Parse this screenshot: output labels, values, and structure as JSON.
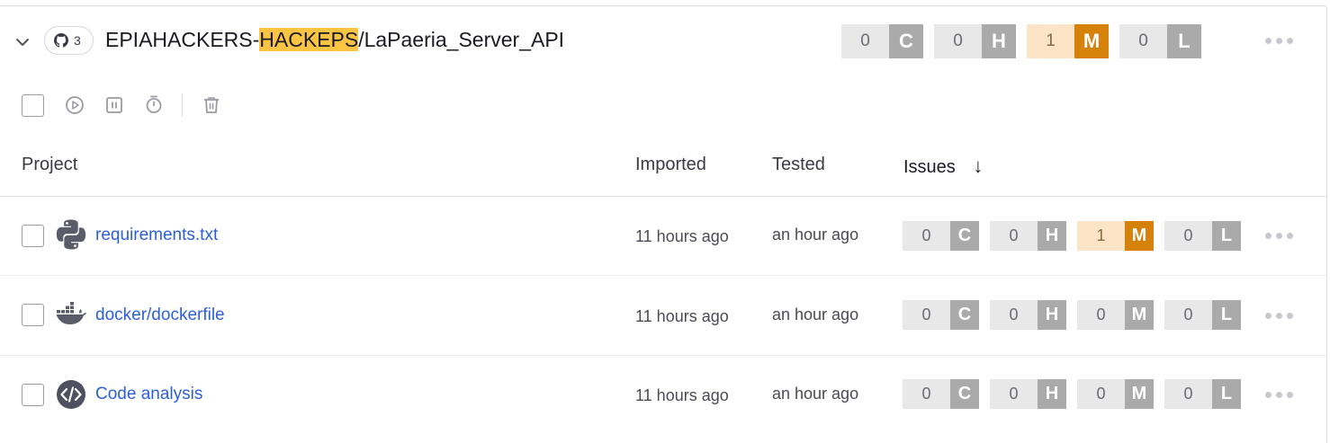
{
  "repo": {
    "source_count": "3",
    "title_prefix": "EPIAHACKERS-",
    "title_highlight": "HACKEPS",
    "title_suffix": "/LaPaeria_Server_API",
    "highlight_color": "#fbc543",
    "summary": {
      "critical": {
        "count": "0",
        "letter": "C"
      },
      "high": {
        "count": "0",
        "letter": "H"
      },
      "medium": {
        "count": "1",
        "letter": "M"
      },
      "low": {
        "count": "0",
        "letter": "L"
      }
    }
  },
  "toolbar": {
    "icons": [
      "select-all-checkbox",
      "play-circle-icon",
      "pause-icon",
      "timer-icon",
      "trash-icon"
    ]
  },
  "columns": {
    "project": "Project",
    "imported": "Imported",
    "tested": "Tested",
    "issues": "Issues",
    "issues_sort": "↓"
  },
  "rows": [
    {
      "icon": "python-icon",
      "name": "requirements.txt",
      "imported": "11 hours ago",
      "tested": "an hour ago",
      "issues": {
        "c": "0",
        "h": "0",
        "m": "1",
        "l": "0",
        "cl": "C",
        "hl": "H",
        "ml": "M",
        "ll": "L"
      }
    },
    {
      "icon": "docker-icon",
      "name": "docker/dockerfile",
      "imported": "11 hours ago",
      "tested": "an hour ago",
      "issues": {
        "c": "0",
        "h": "0",
        "m": "0",
        "l": "0",
        "cl": "C",
        "hl": "H",
        "ml": "M",
        "ll": "L"
      }
    },
    {
      "icon": "code-analysis-icon",
      "name": "Code analysis",
      "imported": "11 hours ago",
      "tested": "an hour ago",
      "issues": {
        "c": "0",
        "h": "0",
        "m": "0",
        "l": "0",
        "cl": "C",
        "hl": "H",
        "ml": "M",
        "ll": "L"
      }
    }
  ],
  "colors": {
    "link": "#2b5fd9",
    "medium": "#d6810a",
    "medium_bg": "#fde4c6",
    "neutral_letter": "#aaaaaa",
    "neutral_bg": "#e8e8e8"
  }
}
